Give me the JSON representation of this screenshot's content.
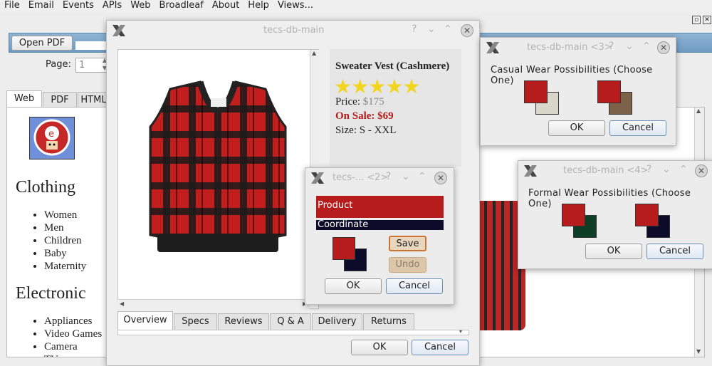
{
  "menubar": [
    "File",
    "Email",
    "Events",
    "APIs",
    "Web",
    "Broadleaf",
    "About",
    "Help",
    "Views..."
  ],
  "top_icons": {
    "restore": "restore-icon",
    "close": "close-icon"
  },
  "browser": {
    "open_pdf": "Open PDF",
    "page_label": "Page:",
    "page_value": "1",
    "tabs": [
      "Web",
      "PDF",
      "HTML"
    ],
    "sections": [
      {
        "title": "Clothing",
        "items": [
          "Women",
          "Men",
          "Children",
          "Baby",
          "Maternity"
        ]
      },
      {
        "title": "Electronic",
        "items": [
          "Appliances",
          "Video Games",
          "Camera",
          "TV"
        ]
      }
    ]
  },
  "main_dialog": {
    "title": "tecs-db-main",
    "product": {
      "name": "Sweater Vest (Cashmere)",
      "stars": 5,
      "price_label": "Price:",
      "price": "$175",
      "sale": "On Sale: $69",
      "size": "Size: S - XXL"
    },
    "tabs": [
      "Overview",
      "Specs",
      "Reviews",
      "Q & A",
      "Delivery",
      "Returns"
    ],
    "ok": "OK",
    "cancel": "Cancel"
  },
  "dialog2": {
    "title": "tecs-... <2>",
    "product": "Product",
    "coordinate": "Coordinate",
    "save": "Save",
    "undo": "Undo",
    "ok": "OK",
    "cancel": "Cancel",
    "colors": {
      "front": "#b71c1c",
      "back": "#0c0c2a"
    }
  },
  "dialog3": {
    "title": "tecs-db-main <3>",
    "heading": "Casual Wear Possibilities (Choose One)",
    "ok": "OK",
    "cancel": "Cancel",
    "pairs": [
      {
        "front": "#b71c1c",
        "back": "#d9d6cb"
      },
      {
        "front": "#b71c1c",
        "back": "#7b6248"
      }
    ]
  },
  "dialog4": {
    "title": "tecs-db-main <4>",
    "heading": "Formal Wear Possibilities (Choose One)",
    "ok": "OK",
    "cancel": "Cancel",
    "pairs": [
      {
        "front": "#b71c1c",
        "back": "#0d3d24"
      },
      {
        "front": "#b71c1c",
        "back": "#0c0c2a"
      }
    ]
  },
  "colors": {
    "accent_red": "#b71c1c",
    "star": "#f1d51f",
    "sale_red": "#b31b1b"
  }
}
